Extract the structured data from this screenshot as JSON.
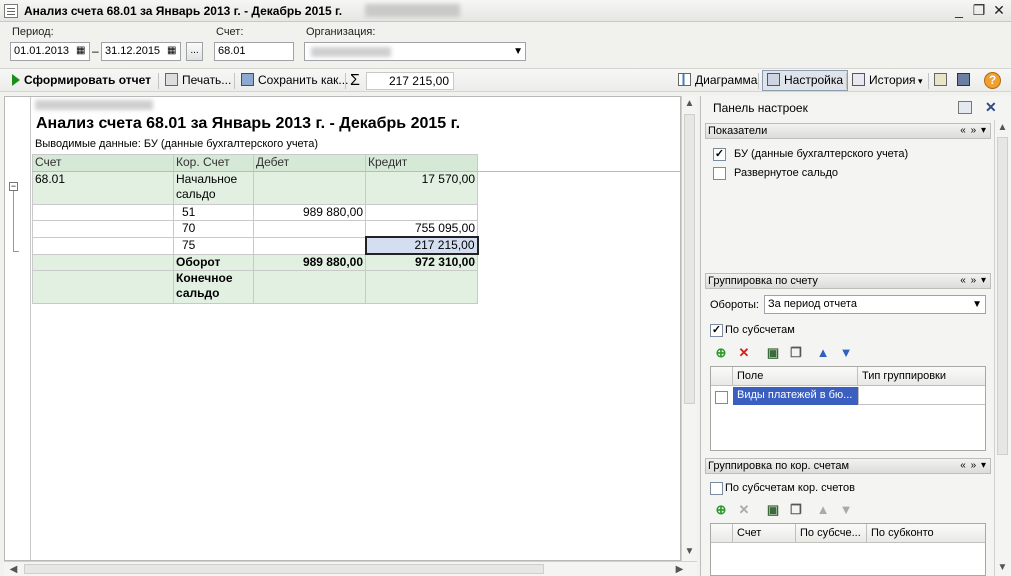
{
  "window": {
    "title": "Анализ счета 68.01 за Январь 2013 г. - Декабрь 2015 г.",
    "controls": [
      "_",
      "❐",
      "✕"
    ]
  },
  "params": {
    "period_label": "Период:",
    "date_from": "01.01.2013",
    "date_to": "31.12.2015",
    "dash": "–",
    "more": "...",
    "account_label": "Счет:",
    "account_value": "68.01",
    "org_label": "Организация:"
  },
  "toolbar": {
    "generate": "Сформировать отчет",
    "print": "Печать...",
    "save": "Сохранить как...",
    "sigma": "Σ",
    "sum": "217 215,00",
    "chart": "Диаграмма",
    "settings": "Настройка",
    "history": "История",
    "help": "?"
  },
  "report": {
    "title": "Анализ счета 68.01 за Январь 2013 г. - Декабрь 2015 г.",
    "subtitle": "Выводимые данные:  БУ (данные бухгалтерского учета)",
    "columns": [
      "Счет",
      "Кор. Счет",
      "Дебет",
      "Кредит"
    ],
    "account": "68.01",
    "opening_label": "Начальное сальдо",
    "opening_credit": "17 570,00",
    "rows": [
      {
        "corr": "51",
        "debit": "989 880,00",
        "credit": ""
      },
      {
        "corr": "70",
        "debit": "",
        "credit": "755 095,00"
      },
      {
        "corr": "75",
        "debit": "",
        "credit": "217 215,00"
      }
    ],
    "turnover_label": "Оборот",
    "turnover_debit": "989 880,00",
    "turnover_credit": "972 310,00",
    "closing_label": "Конечное сальдо"
  },
  "panel": {
    "title": "Панель настроек",
    "indicators_header": "Показатели",
    "ind_bu": "БУ (данные бухгалтерского учета)",
    "ind_expanded": "Развернутое сальдо",
    "group_account_header": "Группировка по счету",
    "turnovers_label": "Обороты:",
    "turnovers_value": "За период отчета",
    "by_subaccounts": "По субсчетам",
    "grid1_cols": [
      "Поле",
      "Тип группировки"
    ],
    "grid1_row": "Виды платежей в бю...",
    "group_corr_header": "Группировка по кор. счетам",
    "by_corr_subaccounts": "По субсчетам кор. счетов",
    "grid2_cols": [
      "Счет",
      "По субсче...",
      "По субконто"
    ],
    "collapse_ctrl": "« » ▾"
  },
  "colors": {
    "header_green": "#d6e8d6",
    "cell_green": "#e2f0e2",
    "selection": "#d3def0",
    "grid_selection": "#3b5fc0"
  }
}
